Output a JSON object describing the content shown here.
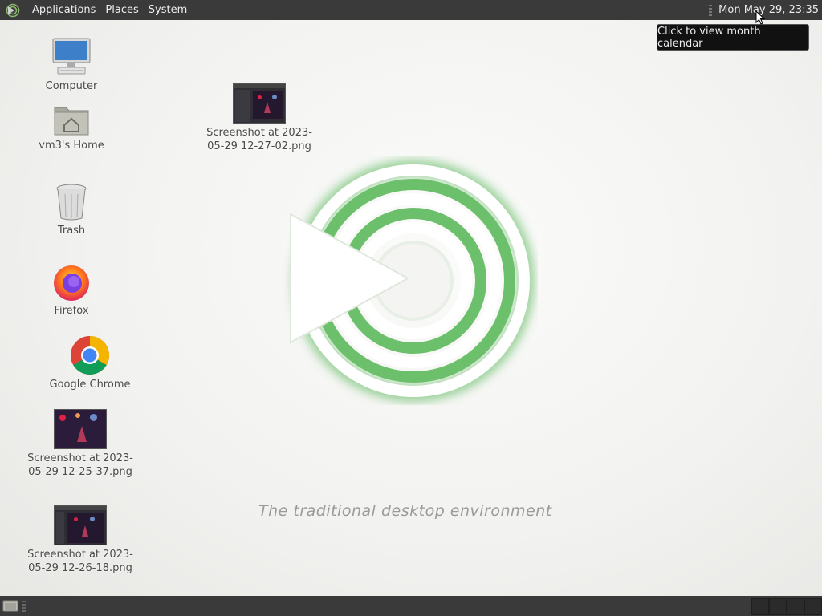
{
  "top_panel": {
    "menus": [
      "Applications",
      "Places",
      "System"
    ],
    "clock": "Mon May 29, 23:35"
  },
  "tooltip": {
    "text": "Click to view month calendar"
  },
  "desktop": {
    "icons": [
      {
        "label": "Computer",
        "icon": "computer-icon"
      },
      {
        "label": "vm3's Home",
        "icon": "home-folder-icon"
      },
      {
        "label": "Trash",
        "icon": "trash-icon"
      },
      {
        "label": "Firefox",
        "icon": "firefox-icon"
      },
      {
        "label": "Google Chrome",
        "icon": "chrome-icon"
      },
      {
        "label_line1": "Screenshot at 2023-",
        "label_line2": "05-29 12-25-37.png",
        "icon": "image-thumbnail-icon"
      },
      {
        "label_line1": "Screenshot at 2023-",
        "label_line2": "05-29 12-26-18.png",
        "icon": "image-thumbnail-icon"
      },
      {
        "label_line1": "Screenshot at 2023-",
        "label_line2": "05-29 12-27-02.png",
        "icon": "image-thumbnail-icon"
      }
    ]
  },
  "wallpaper": {
    "tagline": "The traditional desktop environment",
    "accent": "#5cb85c"
  },
  "colors": {
    "panel": "#3a3a3a",
    "panel_text": "#eeeeec"
  }
}
